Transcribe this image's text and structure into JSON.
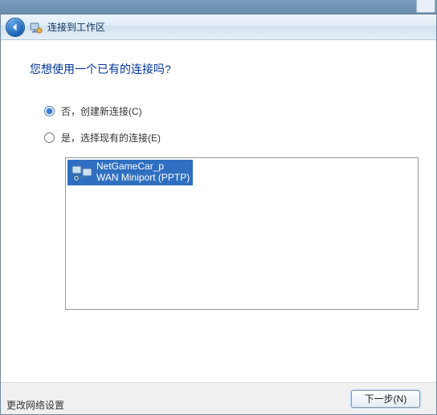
{
  "titlebar": {
    "title": "连接到工作区"
  },
  "content": {
    "heading": "您想使用一个已有的连接吗?",
    "options": {
      "no": {
        "label": "否，创建新连接(C)"
      },
      "yes": {
        "label": "是，选择现有的连接(E)"
      }
    },
    "connections": [
      {
        "name": "NetGameCar_p",
        "device": "WAN Miniport (PPTP)"
      }
    ]
  },
  "buttons": {
    "next": "下一步(N)"
  },
  "footer": {
    "link": "更改网络设置"
  }
}
